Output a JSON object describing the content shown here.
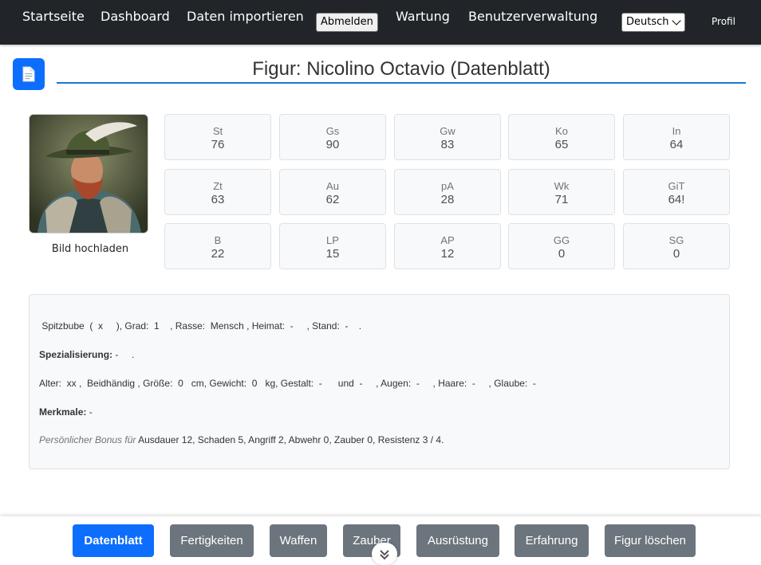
{
  "nav": {
    "items": [
      "Startseite",
      "Dashboard",
      "Daten importieren",
      "Wartung",
      "Benutzerverwaltung"
    ],
    "logout_label": "Abmelden",
    "language": "Deutsch",
    "profile_label": "Profil"
  },
  "header": {
    "title": "Figur: Nicolino Octavio (Datenblatt)",
    "icon": "document-icon"
  },
  "portrait": {
    "upload_label": "Bild hochladen"
  },
  "stats": [
    {
      "label": "St",
      "value": "76"
    },
    {
      "label": "Gs",
      "value": "90"
    },
    {
      "label": "Gw",
      "value": "83"
    },
    {
      "label": "Ko",
      "value": "65"
    },
    {
      "label": "In",
      "value": "64"
    },
    {
      "label": "Zt",
      "value": "63"
    },
    {
      "label": "Au",
      "value": "62"
    },
    {
      "label": "pA",
      "value": "28"
    },
    {
      "label": "Wk",
      "value": "71"
    },
    {
      "label": "GiT",
      "value": "64!"
    },
    {
      "label": "B",
      "value": "22"
    },
    {
      "label": "LP",
      "value": "15"
    },
    {
      "label": "AP",
      "value": "12"
    },
    {
      "label": "GG",
      "value": "0"
    },
    {
      "label": "SG",
      "value": "0"
    }
  ],
  "info": {
    "line1": " Spitzbube  (  x     ), Grad:  1    , Rasse:  Mensch , Heimat:  -     , Stand:  -    .",
    "spec_label": "Spezialisierung:",
    "spec_value": " -     .",
    "line3": "Alter:  xx ,  Beidhändig , Größe:  0   cm, Gewicht:  0   kg, Gestalt:  -      und  -     , Augen:  -     , Haare:  -     , Glaube:  -",
    "traits_label": "Merkmale:",
    "traits_value": " -",
    "bonus_label": "Persönlicher Bonus für",
    "bonus_value": " Ausdauer 12, Schaden 5, Angriff 2, Abwehr 0, Zauber 0, Resistenz 3 / 4."
  },
  "tabs": [
    {
      "label": "Datenblatt",
      "active": true
    },
    {
      "label": "Fertigkeiten",
      "active": false
    },
    {
      "label": "Waffen",
      "active": false
    },
    {
      "label": "Zauber",
      "active": false
    },
    {
      "label": "Ausrüstung",
      "active": false
    },
    {
      "label": "Erfahrung",
      "active": false
    },
    {
      "label": "Figur löschen",
      "active": false
    }
  ],
  "colors": {
    "navbar": "#212529",
    "primary": "#0d6efd",
    "secondary": "#6c757d"
  }
}
